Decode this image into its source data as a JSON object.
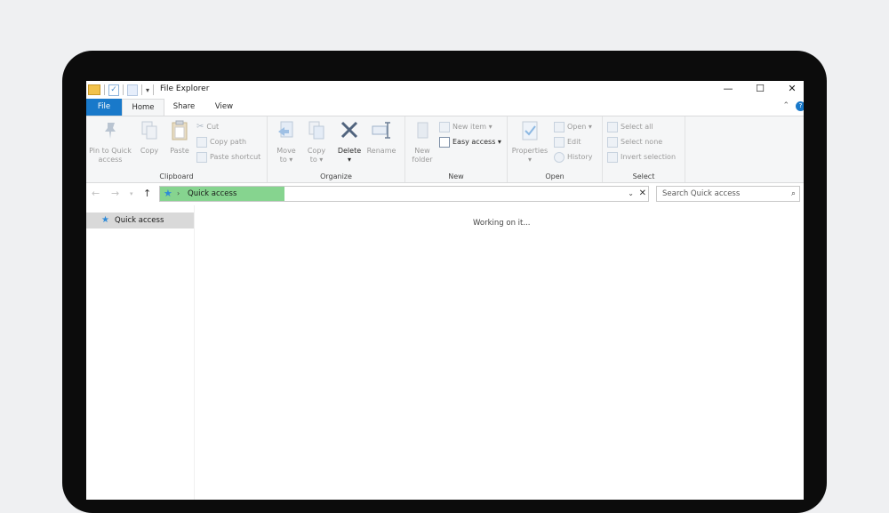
{
  "window": {
    "title": "File Explorer",
    "controls": {
      "minimize": "—",
      "maximize": "☐",
      "close": "✕"
    }
  },
  "tabs": {
    "file": "File",
    "home": "Home",
    "share": "Share",
    "view": "View"
  },
  "ribbon": {
    "clipboard": {
      "label": "Clipboard",
      "pin_line1": "Pin to Quick",
      "pin_line2": "access",
      "copy": "Copy",
      "paste": "Paste",
      "cut": "Cut",
      "copy_path": "Copy path",
      "paste_shortcut": "Paste shortcut"
    },
    "organize": {
      "label": "Organize",
      "move_line1": "Move",
      "move_line2": "to ▾",
      "copy_line1": "Copy",
      "copy_line2": "to ▾",
      "delete_line1": "Delete",
      "delete_line2": "▾",
      "rename": "Rename"
    },
    "new": {
      "label": "New",
      "folder_line1": "New",
      "folder_line2": "folder",
      "new_item": "New item ▾",
      "easy_access": "Easy access ▾"
    },
    "open": {
      "label": "Open",
      "properties_line1": "Properties",
      "properties_line2": "▾",
      "open": "Open ▾",
      "edit": "Edit",
      "history": "History"
    },
    "select": {
      "label": "Select",
      "select_all": "Select all",
      "select_none": "Select none",
      "invert": "Invert selection"
    }
  },
  "address": {
    "path": "Quick access",
    "search_placeholder": "Search Quick access"
  },
  "nav_pane": {
    "quick_access": "Quick access"
  },
  "content": {
    "status": "Working on it..."
  },
  "colors": {
    "file_tab": "#1979ca",
    "address_progress": "#86d48f",
    "star": "#2e8ad8"
  }
}
